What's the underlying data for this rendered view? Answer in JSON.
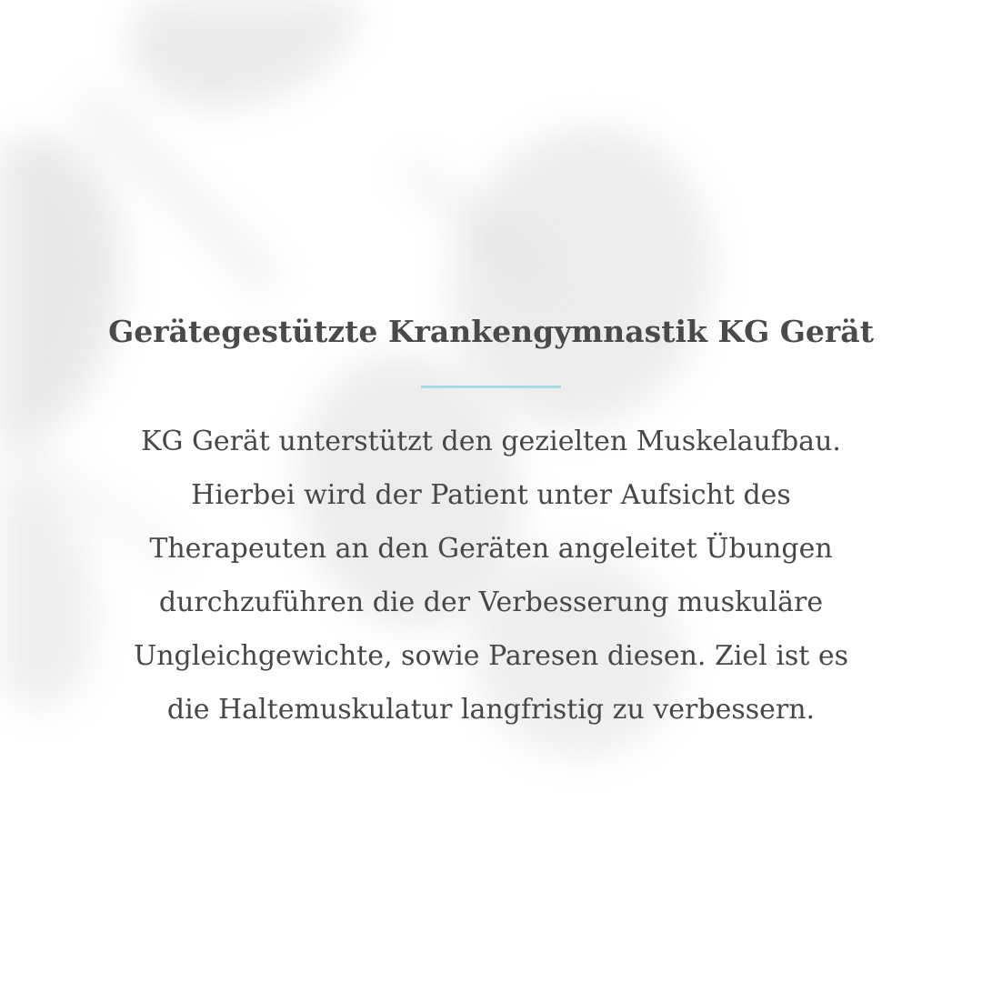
{
  "title": "Gerätegestützte Krankengymnastik KG Gerät",
  "accent_color": "#a3dde3",
  "body_lines": [
    "KG Gerät unterstützt den gezielten Muskelaufbau.",
    "Hierbei wird der Patient unter Aufsicht des",
    "Therapeuten an den Geräten angeleitet Übungen",
    "durchzuführen die der Verbesserung muskuläre",
    "Ungleichgewichte, sowie Paresen diesen. Ziel ist es",
    "die Haltemuskulatur langfristig zu verbessern."
  ]
}
